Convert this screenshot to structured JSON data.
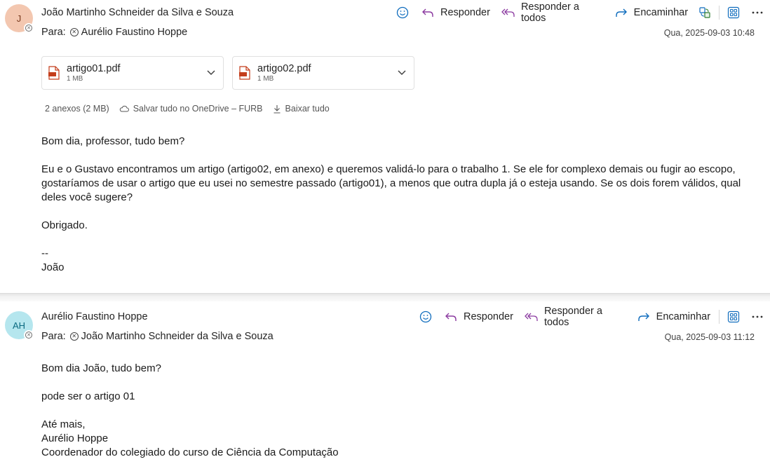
{
  "messages": [
    {
      "avatar_initials": "J",
      "avatar_color": "#f3c7b0",
      "sender": "João Martinho Schneider da Silva e Souza",
      "to_label": "Para:",
      "recipient": "Aurélio Faustino Hoppe",
      "date": "Qua, 2025-09-03 10:48",
      "actions": {
        "reply": "Responder",
        "reply_all": "Responder a todos",
        "forward": "Encaminhar"
      },
      "attachments": [
        {
          "name": "artigo01.pdf",
          "size": "1 MB"
        },
        {
          "name": "artigo02.pdf",
          "size": "1 MB"
        }
      ],
      "attachment_bar": {
        "summary": "2 anexos (2 MB)",
        "save_onedrive": "Salvar tudo no OneDrive – FURB",
        "download_all": "Baixar tudo"
      },
      "body": [
        "Bom dia, professor, tudo bem?",
        "Eu e o Gustavo encontramos um artigo (artigo02, em anexo) e queremos validá-lo para o trabalho 1. Se ele for complexo demais ou fugir ao escopo, gostaríamos de usar o artigo que eu usei no semestre passado (artigo01), a menos que outra dupla já o esteja usando. Se os dois forem válidos, qual deles você sugere?",
        "Obrigado.",
        "--",
        "João"
      ]
    },
    {
      "avatar_initials": "AH",
      "avatar_color": "#b5e6ee",
      "sender": "Aurélio Faustino Hoppe",
      "to_label": "Para:",
      "recipient": "João Martinho Schneider da Silva e Souza",
      "date": "Qua, 2025-09-03 11:12",
      "actions": {
        "reply": "Responder",
        "reply_all": "Responder a todos",
        "forward": "Encaminhar"
      },
      "body": [
        "Bom dia João, tudo bem?",
        "pode ser o artigo 01",
        "Até mais,",
        "Aurélio Hoppe",
        "Coordenador do colegiado do curso de Ciência da Computação"
      ]
    }
  ],
  "colors": {
    "accent_blue": "#0f6cbd",
    "reply_purple": "#8b3aa0",
    "pdf_red": "#c43e1c"
  }
}
